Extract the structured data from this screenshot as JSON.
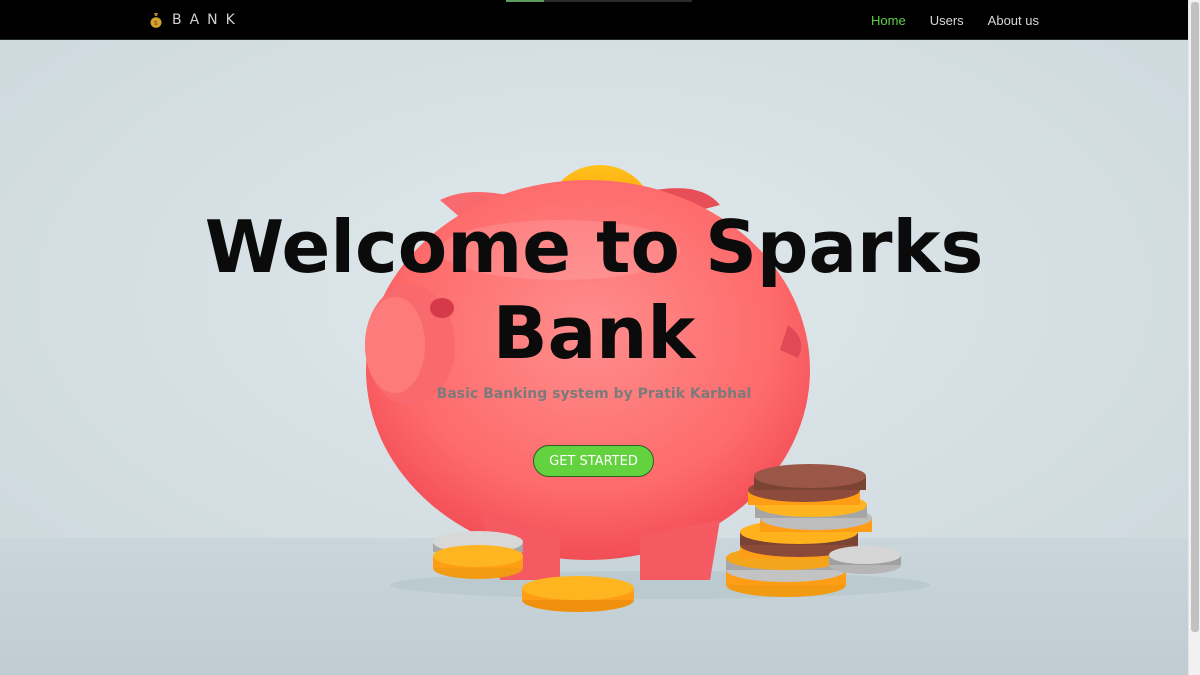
{
  "brand": {
    "logo": "money-bag-icon",
    "text": "BANK"
  },
  "nav": {
    "items": [
      {
        "label": "Home",
        "active": true
      },
      {
        "label": "Users",
        "active": false
      },
      {
        "label": "About us",
        "active": false
      }
    ]
  },
  "hero": {
    "title_lines": [
      "Welcome to Sparks",
      "Bank"
    ],
    "subtitle": "Basic Banking system by Pratik Karbhal",
    "cta_label": "GET STARTED"
  },
  "colors": {
    "navbar": "#000000",
    "nav_active": "#5fd04a",
    "cta": "#62d33e",
    "background": "#d3dee2",
    "piggy": "#fe6e6e",
    "coin_gold": "#ffa31a"
  }
}
